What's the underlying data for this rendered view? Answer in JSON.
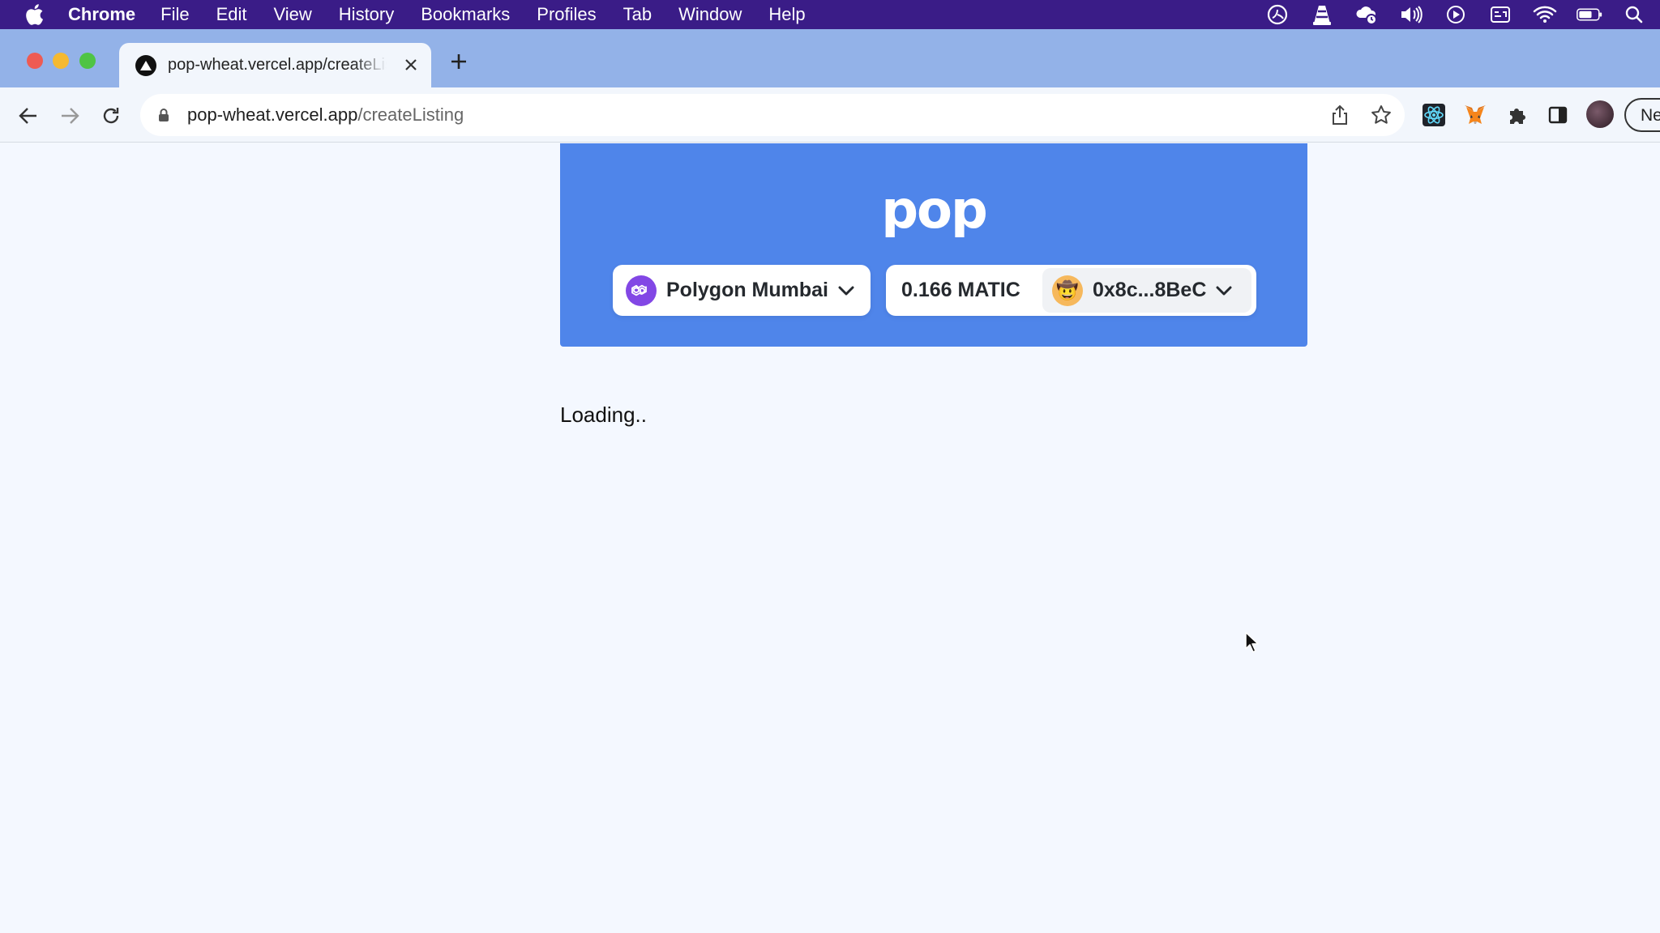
{
  "menubar": {
    "app_name": "Chrome",
    "items": [
      "File",
      "Edit",
      "View",
      "History",
      "Bookmarks",
      "Profiles",
      "Tab",
      "Window",
      "Help"
    ]
  },
  "browser": {
    "tab_title": "pop-wheat.vercel.app/createListing",
    "url_host": "pop-wheat.vercel.app",
    "url_path": "/createListing",
    "profile_label": "New"
  },
  "page": {
    "logo_text": "pop",
    "chain_name": "Polygon Mumbai",
    "balance": "0.166 MATIC",
    "address": "0x8c...8BeC",
    "avatar_emoji": "🤠",
    "loading_text": "Loading.."
  },
  "colors": {
    "menubar": "#3a1c87",
    "header": "#4f85ea",
    "polygon": "#8247e5",
    "page_bg": "#f4f8ff"
  }
}
